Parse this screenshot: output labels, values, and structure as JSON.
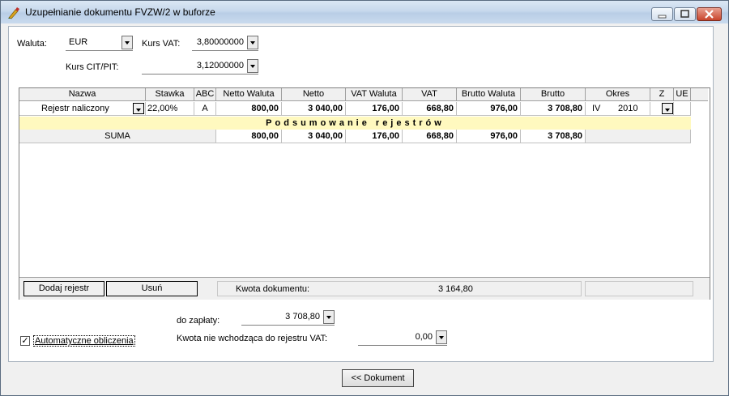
{
  "window": {
    "title": "Uzupełnianie dokumentu FVZW/2 w buforze"
  },
  "top": {
    "waluta_label": "Waluta:",
    "waluta_value": "EUR",
    "kurs_vat_label": "Kurs VAT:",
    "kurs_vat_value": "3,80000000",
    "kurs_cit_label": "Kurs CIT/PIT:",
    "kurs_cit_value": "3,12000000"
  },
  "grid": {
    "columns": [
      "Nazwa",
      "Stawka",
      "ABC",
      "Netto Waluta",
      "Netto",
      "VAT Waluta",
      "VAT",
      "Brutto Waluta",
      "Brutto",
      "Okres",
      "Z",
      "UE"
    ],
    "row": {
      "nazwa": "Rejestr naliczony",
      "stawka": "22,00%",
      "abc": "A",
      "netto_waluta": "800,00",
      "netto": "3 040,00",
      "vat_waluta": "176,00",
      "vat": "668,80",
      "brutto_waluta": "976,00",
      "brutto": "3 708,80",
      "okres_m": "IV",
      "okres_y": "2010"
    },
    "summary_title": "Podsumowanie rejestrów",
    "suma": {
      "label": "SUMA",
      "netto_waluta": "800,00",
      "netto": "3 040,00",
      "vat_waluta": "176,00",
      "vat": "668,80",
      "brutto_waluta": "976,00",
      "brutto": "3 708,80"
    },
    "footer": {
      "add_button": "Dodaj rejestr",
      "delete_button": "Usuń",
      "kwota_label": "Kwota dokumentu:",
      "kwota_value": "3 164,80"
    }
  },
  "bottom": {
    "do_zaplaty_label": "do zapłaty:",
    "do_zaplaty_value": "3 708,80",
    "auto_calc_label": "Automatyczne obliczenia",
    "auto_calc_checked": true,
    "nie_wchodzaca_label": "Kwota nie wchodząca do rejestru VAT:",
    "nie_wchodzaca_value": "0,00",
    "dokument_button": "<< Dokument"
  }
}
